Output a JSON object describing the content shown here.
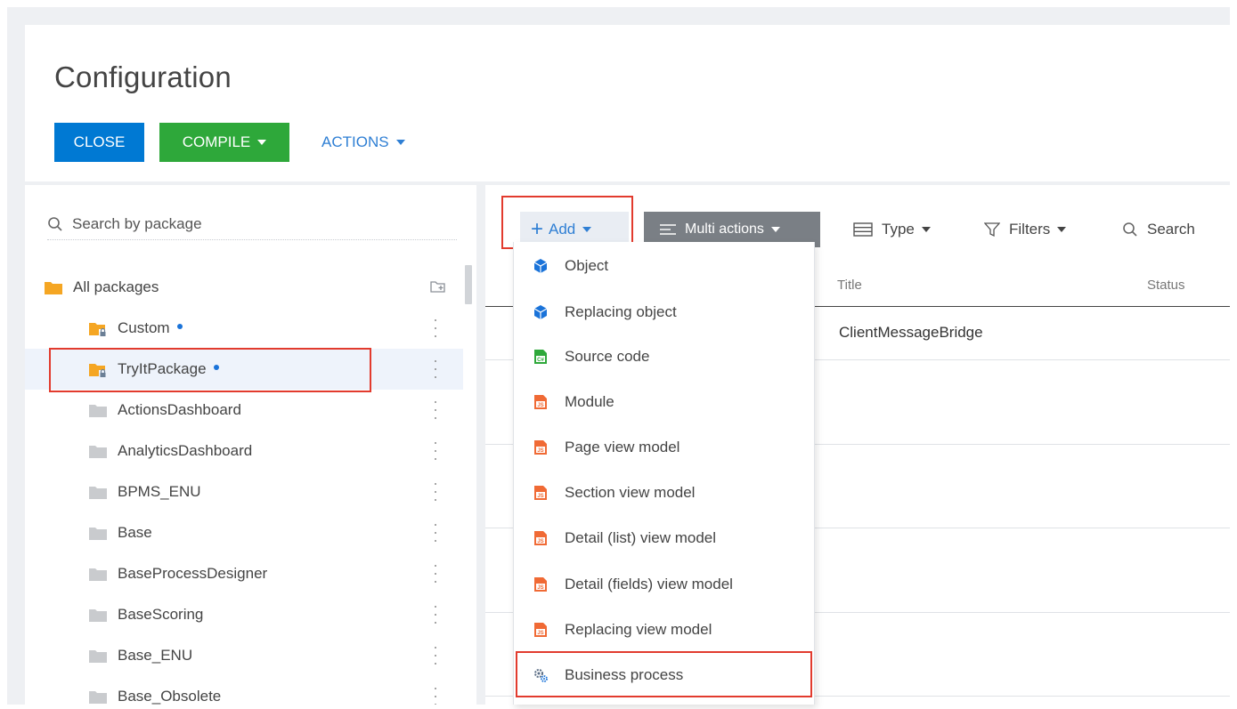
{
  "header": {
    "title": "Configuration",
    "close_label": "CLOSE",
    "compile_label": "COMPILE",
    "actions_label": "ACTIONS"
  },
  "packages": {
    "search_placeholder": "Search by package",
    "root_label": "All packages",
    "items": [
      {
        "label": "Custom",
        "locked": true,
        "modified": true
      },
      {
        "label": "TryItPackage",
        "locked": true,
        "modified": true,
        "selected": true
      },
      {
        "label": "ActionsDashboard"
      },
      {
        "label": "AnalyticsDashboard"
      },
      {
        "label": "BPMS_ENU"
      },
      {
        "label": "Base"
      },
      {
        "label": "BaseProcessDesigner"
      },
      {
        "label": "BaseScoring"
      },
      {
        "label": "Base_ENU"
      },
      {
        "label": "Base_Obsolete"
      }
    ]
  },
  "toolbar": {
    "add_label": "Add",
    "multi_actions_label": "Multi actions",
    "type_label": "Type",
    "filters_label": "Filters",
    "search_label": "Search"
  },
  "grid": {
    "columns": {
      "title": "Title",
      "status": "Status"
    },
    "rows": [
      {
        "title": "ClientMessageBridge"
      }
    ]
  },
  "add_menu": {
    "items": [
      {
        "label": "Object",
        "icon": "object-cube-icon"
      },
      {
        "label": "Replacing object",
        "icon": "object-cube-icon"
      },
      {
        "label": "Source code",
        "icon": "source-code-icon"
      },
      {
        "label": "Module",
        "icon": "js-file-icon"
      },
      {
        "label": "Page view model",
        "icon": "js-file-icon"
      },
      {
        "label": "Section view model",
        "icon": "js-file-icon"
      },
      {
        "label": "Detail (list) view model",
        "icon": "js-file-icon"
      },
      {
        "label": "Detail (fields) view model",
        "icon": "js-file-icon"
      },
      {
        "label": "Replacing view model",
        "icon": "js-file-icon"
      },
      {
        "label": "Business process",
        "icon": "business-process-gears-icon"
      }
    ]
  },
  "colors": {
    "close_button": "#0079d3",
    "compile_button": "#2ea83a",
    "link_blue": "#2f7fd4",
    "highlight_red": "#e23b2e",
    "folder_orange": "#f5a623",
    "folder_gray": "#c9cbce"
  }
}
